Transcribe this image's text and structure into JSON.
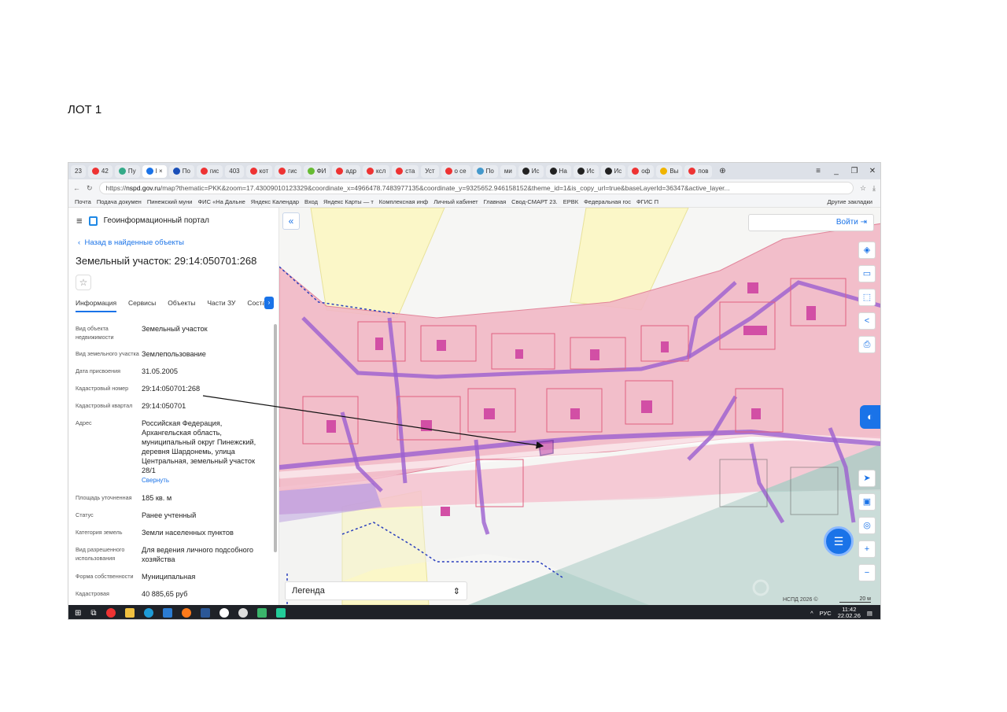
{
  "lot_title": "ЛОТ 1",
  "browser": {
    "tabs": [
      "23",
      "42",
      "Пу",
      "I ×",
      "По",
      "гис",
      "403",
      "кот",
      "гис",
      "ФИ",
      "адр",
      "ксл",
      "ста",
      "Уст",
      "о се",
      "По",
      "ми",
      "Ис",
      "На",
      "Ис",
      "Ис",
      "оф",
      "Вы",
      "пов"
    ],
    "active_tab_index": 3,
    "url_prefix": "https://",
    "url_host": "nspd.gov.ru",
    "url_rest": "/map?thematic=PKK&zoom=17.43009010123329&coordinate_x=4966478.7483977135&coordinate_y=9325652.946158152&theme_id=1&is_copy_url=true&baseLayerId=36347&active_layer...",
    "bookmarks": [
      "Почта",
      "Подача докумен",
      "Пинежский муни",
      "ФИС «На Дальне",
      "Яндекс Календар",
      "Вход",
      "Яндекс Карты — т",
      "Комплексная инф",
      "Личный кабинет",
      "Главная",
      "Свод-СМАРТ 23.",
      "ЕРВК",
      "Федеральная гос",
      "ФГИС П"
    ],
    "other_bookmarks": "Другие закладки"
  },
  "panel": {
    "portal_name": "Геоинформационный портал",
    "back_label": "Назад в найденные объекты",
    "parcel_title": "Земельный участок: 29:14:050701:268",
    "tabs": [
      "Информация",
      "Сервисы",
      "Объекты",
      "Части ЗУ",
      "Состав"
    ],
    "properties": [
      {
        "key": "Вид объекта недвижимости",
        "value": "Земельный участок"
      },
      {
        "key": "Вид земельного участка",
        "value": "Землепользование"
      },
      {
        "key": "Дата присвоения",
        "value": "31.05.2005"
      },
      {
        "key": "Кадастровый номер",
        "value": "29:14:050701:268"
      },
      {
        "key": "Кадастровый квартал",
        "value": "29:14:050701"
      },
      {
        "key": "Адрес",
        "value": "Российская Федерация, Архангельская область, муниципальный округ Пинежский, деревня Шардонемь, улица Центральная, земельный участок 28/1"
      },
      {
        "key": "Площадь уточненная",
        "value": "185 кв. м"
      },
      {
        "key": "Статус",
        "value": "Ранее учтенный"
      },
      {
        "key": "Категория земель",
        "value": "Земли населенных пунктов"
      },
      {
        "key": "Вид разрешенного использования",
        "value": "Для ведения личного подсобного хозяйства"
      },
      {
        "key": "Форма собственности",
        "value": "Муниципальная"
      },
      {
        "key": "Кадастровая",
        "value": "40 885,65 руб"
      }
    ],
    "collapse_link": "Свернуть"
  },
  "map": {
    "login_label": "Войти",
    "legend_label": "Легенда",
    "copyright": "НСПД 2026 ©",
    "scale_label": "20 м",
    "colors": {
      "zone_pink": "#f2b8c6",
      "zone_yellow": "#fbf7c8",
      "zone_green": "#a9ccc4",
      "road_purple": "#9b5fd0",
      "parcel_magenta": "#d24fa5",
      "accent_blue": "#1a73e8"
    }
  },
  "taskbar": {
    "tray_lang": "РУС",
    "time": "11:42",
    "date": "22.02.26"
  }
}
